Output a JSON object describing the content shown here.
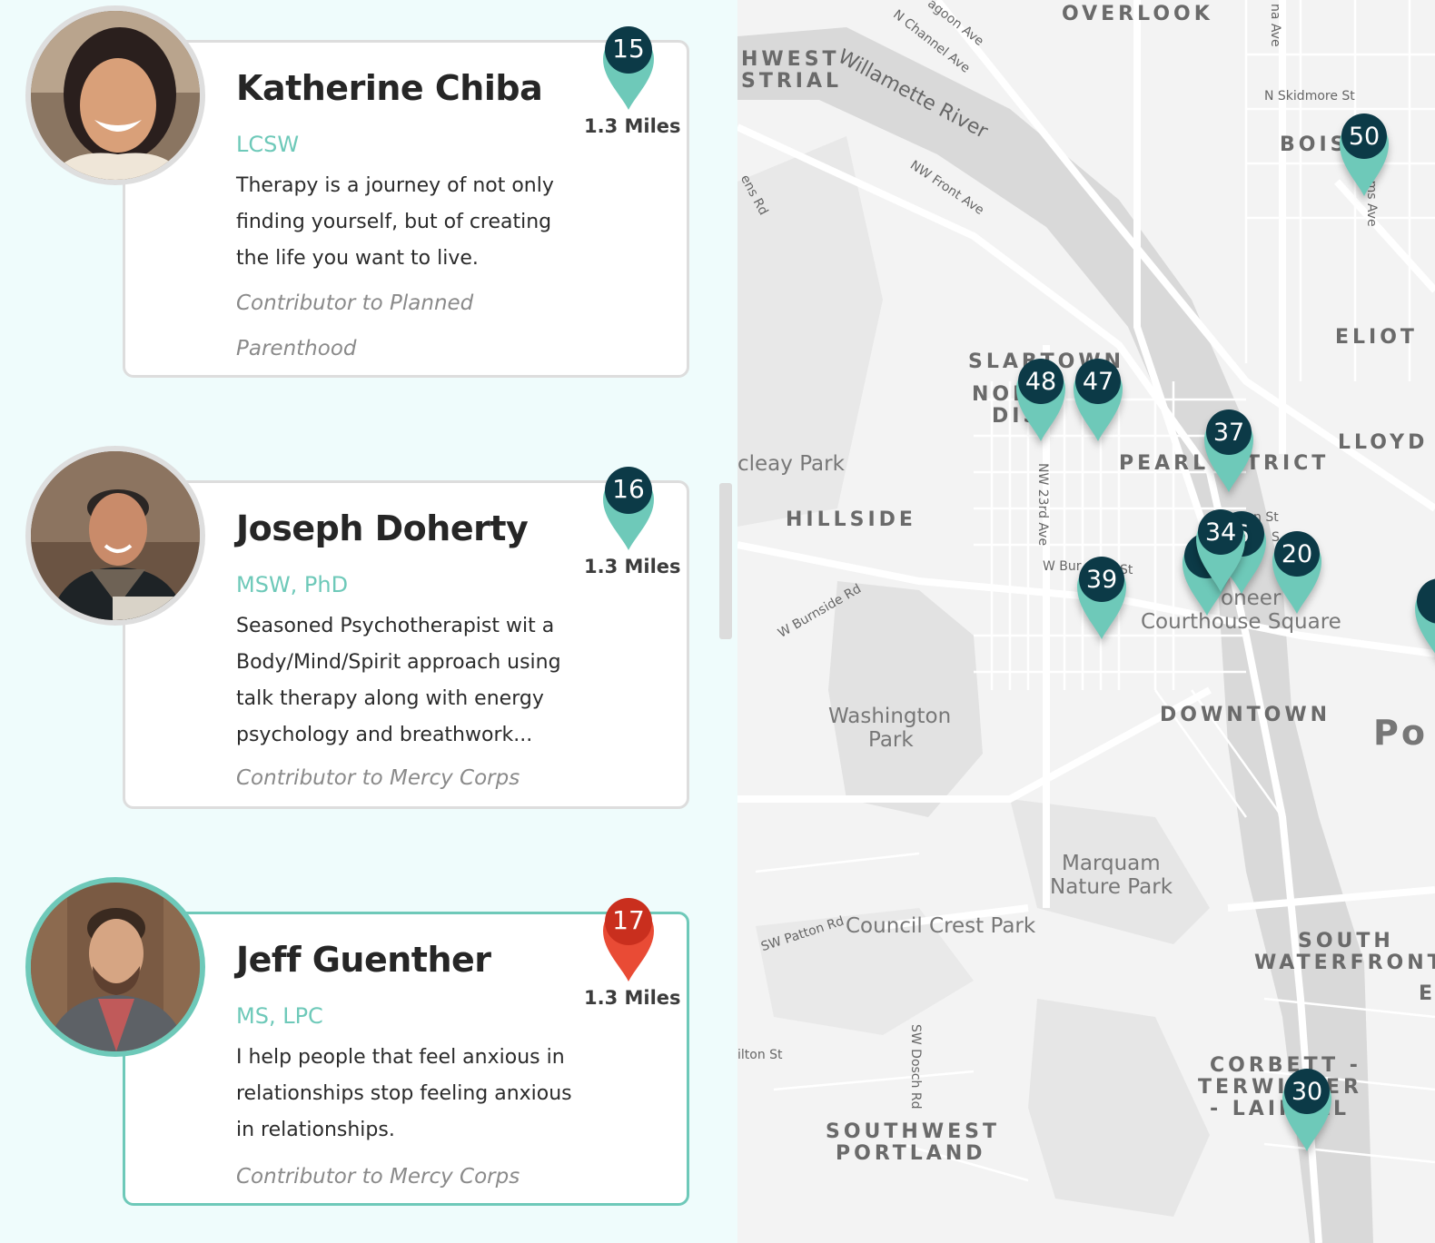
{
  "colors": {
    "accent": "#6ec9b9",
    "pin_dark": "#0c3a47",
    "pin_selected": "#e94b35",
    "pin_selected_dark": "#c92f1e",
    "card_border": "#dddddd",
    "list_background": "#effcfc"
  },
  "therapists": [
    {
      "pin_number": "15",
      "name": "Katherine Chiba",
      "credentials": "LCSW",
      "bio": "Therapy is a journey of not only finding yourself, but of creating the life you want to live.",
      "contributor": "Contributor to Planned Parenthood",
      "distance": "1.3 Miles",
      "selected": false
    },
    {
      "pin_number": "16",
      "name": "Joseph Doherty",
      "credentials": "MSW, PhD",
      "bio": "Seasoned Psychotherapist wit a Body/Mind/Spirit approach using talk therapy along with energy psychology and breathwork...",
      "contributor": "Contributor to Mercy Corps",
      "distance": "1.3 Miles",
      "selected": false
    },
    {
      "pin_number": "17",
      "name": "Jeff Guenther",
      "credentials": "MS, LPC",
      "bio": "I help people that feel anxious in relationships stop feeling anxious in relationships.",
      "contributor": "Contributor to Mercy Corps",
      "distance": "1.3 Miles",
      "selected": true
    }
  ],
  "map": {
    "area_labels": {
      "overlook": "OVERLOOK",
      "northwest_industrial_1": "HWEST",
      "northwest_industrial_2": "STRIAL",
      "boise": "BOIS",
      "eliot": "ELIOT",
      "slabtown": "SLABTOWN",
      "northwest_district_1": "NOR",
      "northwest_district_2": "DIS",
      "lloyd": "LLOYD",
      "pearl_district_1": "PEARL",
      "pearl_district_2": "TRICT",
      "hillside": "HILLSIDE",
      "downtown": "DOWNTOWN",
      "south_waterfront_1": "SOUTH",
      "south_waterfront_2": "WATERFRONT",
      "corbett_1": "CORBETT -",
      "corbett_2": "TERWI",
      "corbett_3": "ER",
      "corbett_4": "- LAIR",
      "corbett_5": "LL",
      "southwest_portland_1": "SOUTHWEST",
      "southwest_portland_2": "PORTLAND",
      "portland_partial": "Po",
      "e_partial": "E"
    },
    "place_labels": {
      "macleay_park": "cleay Park",
      "washington_park_1": "Washington",
      "washington_park_2": "Park",
      "pioneer_square_1": "oneer",
      "pioneer_square_2": "Courthouse Square",
      "marquam_1": "Marquam",
      "marquam_2": "Nature Park",
      "council_crest": "Council Crest Park"
    },
    "river_label": "Willamette River",
    "street_labels": {
      "lagoon": "agoon Ave",
      "channel": "N Channel Ave",
      "skidmore": "N Skidmore St",
      "na_ave": "na Ave",
      "front_ave": "NW Front Ave",
      "ens_rd": "ens Rd",
      "williams": "ams Ave",
      "nw_23rd": "NW 23rd Ave",
      "w_burnside_short": "W Bur",
      "w_burnside_st": "St",
      "w_burnside_rd": "W Burnside Rd",
      "n_st": "n St",
      "s_partial": "S",
      "sw_patton": "SW Patton Rd",
      "hamilton": "ilton St",
      "sw_dosch": "SW Dosch Rd"
    },
    "pins": [
      "48",
      "47",
      "37",
      "34",
      "6",
      "20",
      "39",
      "50",
      "30",
      ""
    ]
  }
}
